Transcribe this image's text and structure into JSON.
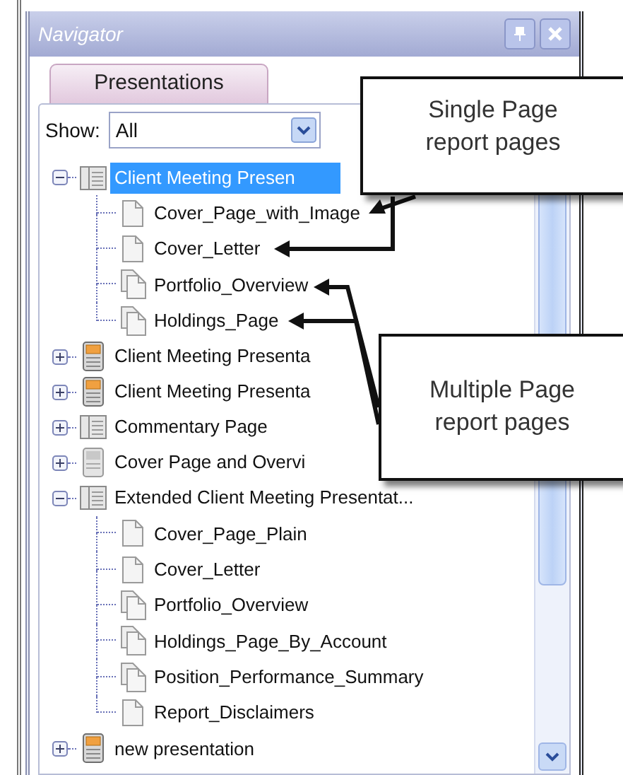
{
  "window": {
    "title": "Navigator"
  },
  "title_buttons": [
    {
      "kind": "pin"
    },
    {
      "kind": "close"
    }
  ],
  "tabs": [
    {
      "label": "Presentations",
      "selected": true
    }
  ],
  "show": {
    "label": "Show:",
    "value": "All"
  },
  "tree": [
    {
      "label": "Client Meeting Presen",
      "kind": "book",
      "expanded": true,
      "selected": true,
      "children": [
        {
          "label": "Cover_Page_with_Image",
          "kind": "page",
          "selected": false
        },
        {
          "label": "Cover_Letter",
          "kind": "page",
          "selected": false
        },
        {
          "label": "Portfolio_Overview",
          "kind": "pages",
          "selected": false
        },
        {
          "label": "Holdings_Page",
          "kind": "pages",
          "selected": false
        }
      ]
    },
    {
      "label": "Client Meeting Presenta",
      "kind": "slides",
      "expanded": false,
      "selected": false
    },
    {
      "label": "Client Meeting Presenta",
      "kind": "slides",
      "expanded": false,
      "selected": false
    },
    {
      "label": "Commentary Page",
      "kind": "book",
      "expanded": false,
      "selected": false
    },
    {
      "label": "Cover Page and Overvi",
      "kind": "deck",
      "expanded": false,
      "selected": false
    },
    {
      "label": "Extended Client Meeting Presentat...",
      "kind": "book",
      "expanded": true,
      "selected": false,
      "children": [
        {
          "label": "Cover_Page_Plain",
          "kind": "page",
          "selected": false
        },
        {
          "label": "Cover_Letter",
          "kind": "page",
          "selected": false
        },
        {
          "label": "Portfolio_Overview",
          "kind": "pages",
          "selected": false
        },
        {
          "label": "Holdings_Page_By_Account",
          "kind": "pages",
          "selected": false
        },
        {
          "label": "Position_Performance_Summary",
          "kind": "pages",
          "selected": false
        },
        {
          "label": "Report_Disclaimers",
          "kind": "page",
          "selected": false
        }
      ]
    },
    {
      "label": "new presentation",
      "kind": "slides",
      "expanded": false,
      "selected": false
    }
  ],
  "callouts": [
    {
      "text": "Single Page report pages"
    },
    {
      "text": "Multiple Page report pages"
    }
  ]
}
